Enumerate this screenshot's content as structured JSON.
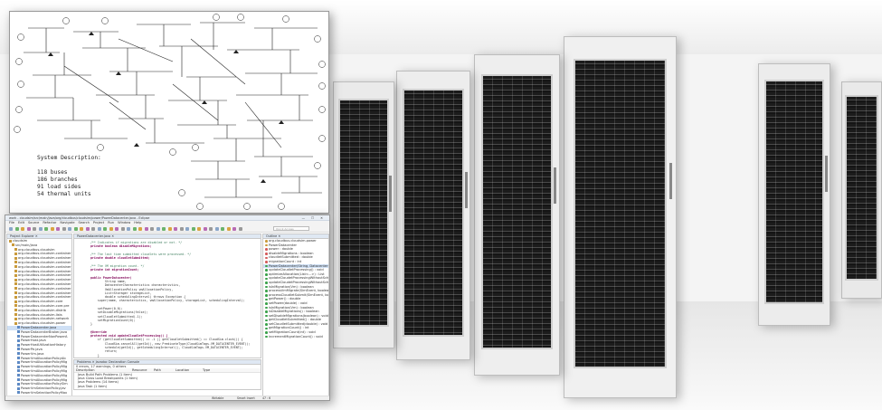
{
  "diagram": {
    "system_description_title": "System Description:",
    "lines": [
      "118 buses",
      "186 branches",
      "91 load sides",
      "54 thermal units"
    ]
  },
  "ide": {
    "title": "work - cloudsim/src/main/java/org/cloudbus/cloudsim/power/PowerDatacenter.java - Eclipse",
    "window_controls": "— ☐ ✕",
    "menu": [
      "File",
      "Edit",
      "Source",
      "Refactor",
      "Navigate",
      "Search",
      "Project",
      "Run",
      "Window",
      "Help"
    ],
    "quick_access_placeholder": "Quick Access",
    "package_explorer": {
      "tab": "Project Explorer ✕",
      "items": [
        "cloudsim",
        "src/main/java",
        "org.cloudbus.cloudsim",
        "org.cloudbus.cloudsim.container",
        "org.cloudbus.cloudsim.container",
        "org.cloudbus.cloudsim.container",
        "org.cloudbus.cloudsim.container",
        "org.cloudbus.cloudsim.container",
        "org.cloudbus.cloudsim.container",
        "org.cloudbus.cloudsim.container",
        "org.cloudbus.cloudsim.container",
        "org.cloudbus.cloudsim.container",
        "org.cloudbus.cloudsim.container",
        "org.cloudbus.cloudsim.container",
        "org.cloudbus.cloudsim.core",
        "org.cloudbus.cloudsim.core.pre",
        "org.cloudbus.cloudsim.distrib",
        "org.cloudbus.cloudsim.lists",
        "org.cloudbus.cloudsim.network",
        "org.cloudbus.cloudsim.power",
        "PowerDatacenter.java",
        "PowerDatacenterBroker.java",
        "PowerDatacenterNonPowerA",
        "PowerHost.java",
        "PowerHostUtilizationHistory",
        "PowerPe.java",
        "PowerVm.java",
        "PowerVmAllocationPolicyAb",
        "PowerVmAllocationPolicyMig",
        "PowerVmAllocationPolicyMig",
        "PowerVmAllocationPolicyMig",
        "PowerVmAllocationPolicyMig",
        "PowerVmAllocationPolicyMig",
        "PowerVmAllocationPolicySim",
        "PowerVmSelectionPolicy.jav",
        "PowerVmSelectionPolicyMax",
        "PowerVmSelectionPolicyMin"
      ],
      "selected_index": 20
    },
    "editor": {
      "tab": "PowerDatacenter.java ✕",
      "lines": [
        "    /** Indicates if migrations are disabled or not. */",
        "    private boolean disableMigrations;",
        "",
        "    /** The last time submitted cloudlets were processed. */",
        "    private double cloudletSubmitted;",
        "",
        "    /** The VM migration count. */",
        "    private int migrationCount;",
        "",
        "    public PowerDatacenter(",
        "            String name,",
        "            DatacenterCharacteristics characteristics,",
        "            VmAllocationPolicy vmAllocationPolicy,",
        "            List<Storage> storageList,",
        "            double schedulingInterval) throws Exception {",
        "        super(name, characteristics, vmAllocationPolicy, storageList, schedulingInterval);",
        "",
        "        setPower(0.0);",
        "        setDisableMigrations(false);",
        "        setCloudletSubmitted(-1);",
        "        setMigrationCount(0);",
        "    }",
        "",
        "    @Override",
        "    protected void updateCloudletProcessing() {",
        "        if (getCloudletSubmitted() == -1 || getCloudletSubmitted() == CloudSim.clock()) {",
        "            CloudSim.cancelAll(getId(), new PredicateType(CloudSimTags.VM_DATACENTER_EVENT));",
        "            schedule(getId(), getSchedulingInterval(), CloudSimTags.VM_DATACENTER_EVENT);",
        "            return;",
        "        }",
        "        double currentTime = CloudSim.clock();",
        "",
        "        // if some time passed since last processing",
        "        if (currentTime > getLastProcessTime()) {"
      ]
    },
    "outline": {
      "tab": "Outline ✕",
      "items": [
        "org.cloudbus.cloudsim.power",
        "PowerDatacenter",
        "power : double",
        "disableMigrations : boolean",
        "cloudletSubmitted : double",
        "migrationCount : int",
        "PowerDatacenter(String, DatacenterCharacte",
        "updateCloudletProcessing() : void",
        "optimizeAllocation(List<...>) : List",
        "updateCloudetProcessingWithoutSchedulingFu",
        "updateCloudetProcessingWithoutSchedulingFu",
        "isInMigration(Vm) : boolean",
        "processVmMigrate(SimEvent, boolean) : void",
        "processCloudletSubmit(SimEvent, boolean) : v",
        "getPower() : double",
        "setPower(double) : void",
        "isInMigration(Vm) : boolean",
        "isDisableMigrations() : boolean",
        "setDisableMigrations(boolean) : void",
        "getCloudletSubmitted() : double",
        "setCloudletSubmitted(double) : void",
        "getMigrationCount() : int",
        "setMigrationCount(int) : void",
        "incrementMigrationCount() : void"
      ],
      "selected_index": 6
    },
    "problems": {
      "tabs": "Problems ✕  Javadoc  Declaration  Console",
      "summary": "0 errors, 17 warnings, 0 others",
      "columns": [
        "Description",
        "Resource",
        "Path",
        "Location",
        "Type"
      ],
      "rows": [
        "Java Build Path Problems (1 item)",
        "Java Class Load Breakpoints (1 item)",
        "Java Problems (14 items)",
        "Java Task (1 item)"
      ]
    },
    "status": {
      "writable": "Writable",
      "insert": "Smart Insert",
      "position": "47 : 6"
    }
  }
}
